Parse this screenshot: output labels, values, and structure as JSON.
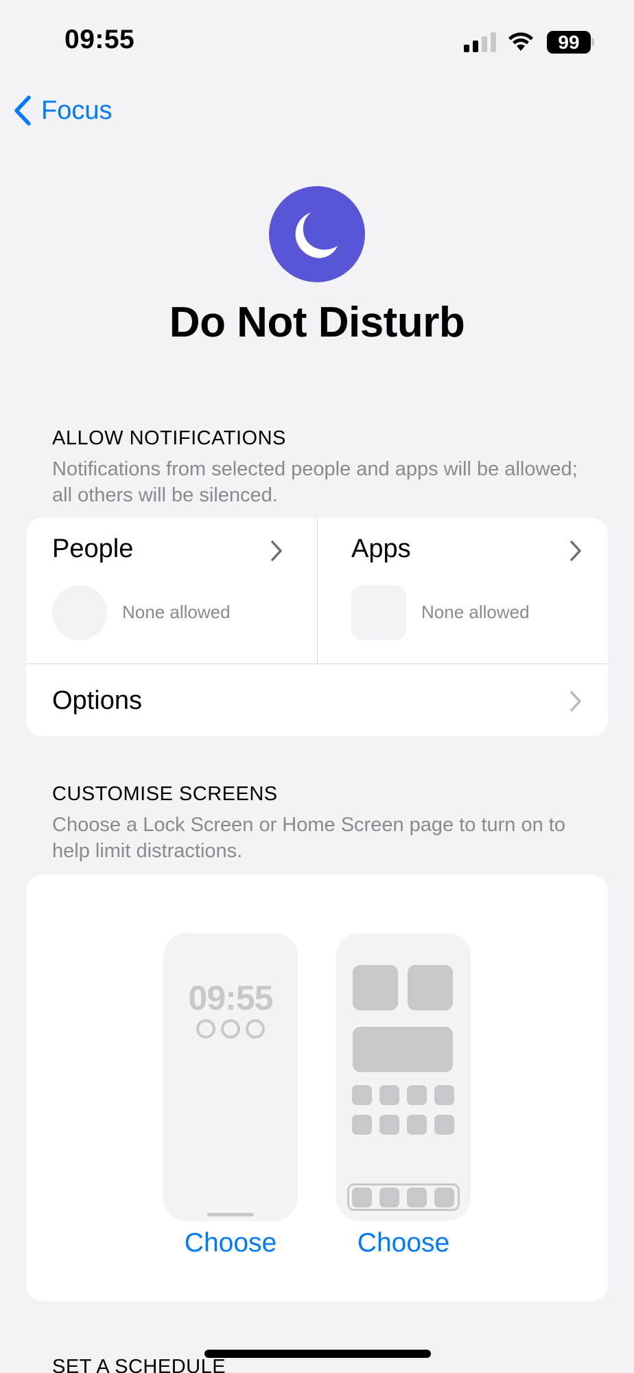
{
  "status_bar": {
    "time": "09:55",
    "battery": "99",
    "signal_bars_active": 2,
    "signal_bars_total": 4,
    "icons": [
      "cellular-signal-icon",
      "wifi-icon",
      "battery-icon"
    ]
  },
  "nav": {
    "back_label": "Focus",
    "back_icon": "chevron-left-icon"
  },
  "header": {
    "icon": "moon-icon",
    "icon_color": "#5856D6",
    "title": "Do Not Disturb"
  },
  "allow_notifications": {
    "title": "ALLOW NOTIFICATIONS",
    "description": "Notifications from selected people and apps will be allowed; all others will be silenced.",
    "people": {
      "label": "People",
      "status": "None allowed"
    },
    "apps": {
      "label": "Apps",
      "status": "None allowed"
    },
    "options": {
      "label": "Options"
    }
  },
  "customise_screens": {
    "title": "CUSTOMISE SCREENS",
    "description": "Choose a Lock Screen or Home Screen page to turn on to help limit distractions.",
    "lock_screen": {
      "time": "09:55",
      "choose_label": "Choose"
    },
    "home_screen": {
      "choose_label": "Choose"
    }
  },
  "schedule": {
    "title": "SET A SCHEDULE"
  },
  "colors": {
    "accent": "#007AFF",
    "focus": "#5856D6",
    "background": "#F2F2F7"
  }
}
